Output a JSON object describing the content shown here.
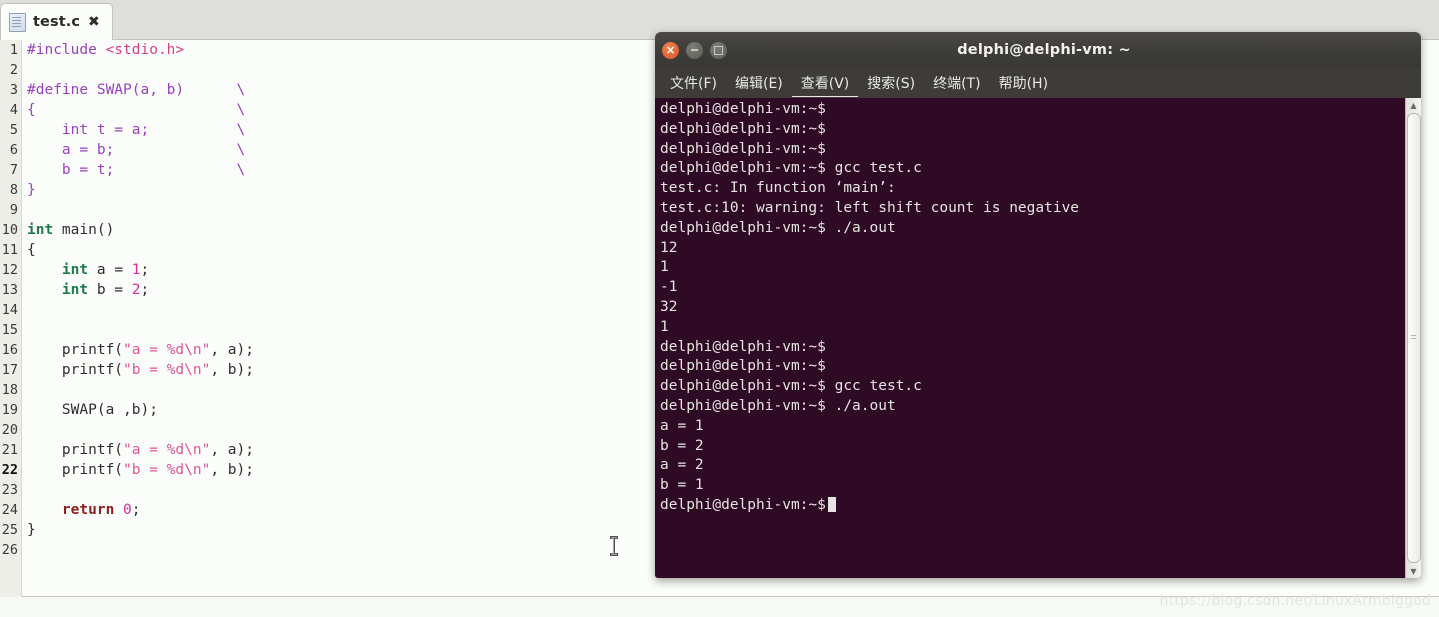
{
  "editor": {
    "tab": {
      "label": "test.c",
      "close_glyph": "✖",
      "icon": "document-icon"
    },
    "gutter_bg": "#edeee8",
    "background": "#fbfdfa",
    "current_line": 22,
    "lines": [
      {
        "n": 1,
        "tokens": [
          {
            "t": "#include ",
            "c": "pre"
          },
          {
            "t": "<stdio.h>",
            "c": "inc"
          }
        ]
      },
      {
        "n": 2,
        "tokens": []
      },
      {
        "n": 3,
        "tokens": [
          {
            "t": "#define SWAP(a, b)      \\",
            "c": "pre"
          }
        ]
      },
      {
        "n": 4,
        "tokens": [
          {
            "t": "{                       \\",
            "c": "pre"
          }
        ]
      },
      {
        "n": 5,
        "tokens": [
          {
            "t": "    int t = a;          \\",
            "c": "pre"
          }
        ]
      },
      {
        "n": 6,
        "tokens": [
          {
            "t": "    a = b;              \\",
            "c": "pre"
          }
        ]
      },
      {
        "n": 7,
        "tokens": [
          {
            "t": "    b = t;              \\",
            "c": "pre"
          }
        ]
      },
      {
        "n": 8,
        "tokens": [
          {
            "t": "}",
            "c": "pre"
          }
        ]
      },
      {
        "n": 9,
        "tokens": []
      },
      {
        "n": 10,
        "tokens": [
          {
            "t": "int",
            "c": "kw"
          },
          {
            "t": " main()",
            "c": "plain"
          }
        ]
      },
      {
        "n": 11,
        "tokens": [
          {
            "t": "{",
            "c": "plain"
          }
        ]
      },
      {
        "n": 12,
        "tokens": [
          {
            "t": "    ",
            "c": "plain"
          },
          {
            "t": "int",
            "c": "kw"
          },
          {
            "t": " a = ",
            "c": "plain"
          },
          {
            "t": "1",
            "c": "num"
          },
          {
            "t": ";",
            "c": "plain"
          }
        ]
      },
      {
        "n": 13,
        "tokens": [
          {
            "t": "    ",
            "c": "plain"
          },
          {
            "t": "int",
            "c": "kw"
          },
          {
            "t": " b = ",
            "c": "plain"
          },
          {
            "t": "2",
            "c": "num"
          },
          {
            "t": ";",
            "c": "plain"
          }
        ]
      },
      {
        "n": 14,
        "tokens": []
      },
      {
        "n": 15,
        "tokens": []
      },
      {
        "n": 16,
        "tokens": [
          {
            "t": "    printf(",
            "c": "plain"
          },
          {
            "t": "\"a = %d\\n\"",
            "c": "str"
          },
          {
            "t": ", a);",
            "c": "plain"
          }
        ]
      },
      {
        "n": 17,
        "tokens": [
          {
            "t": "    printf(",
            "c": "plain"
          },
          {
            "t": "\"b = %d\\n\"",
            "c": "str"
          },
          {
            "t": ", b);",
            "c": "plain"
          }
        ]
      },
      {
        "n": 18,
        "tokens": []
      },
      {
        "n": 19,
        "tokens": [
          {
            "t": "    SWAP(a ,b);",
            "c": "plain"
          }
        ]
      },
      {
        "n": 20,
        "tokens": []
      },
      {
        "n": 21,
        "tokens": [
          {
            "t": "    printf(",
            "c": "plain"
          },
          {
            "t": "\"a = %d\\n\"",
            "c": "str"
          },
          {
            "t": ", a);",
            "c": "plain"
          }
        ]
      },
      {
        "n": 22,
        "tokens": [
          {
            "t": "    printf(",
            "c": "plain"
          },
          {
            "t": "\"b = %d\\n\"",
            "c": "str"
          },
          {
            "t": ", b);",
            "c": "plain"
          }
        ]
      },
      {
        "n": 23,
        "tokens": []
      },
      {
        "n": 24,
        "tokens": [
          {
            "t": "    ",
            "c": "plain"
          },
          {
            "t": "return",
            "c": "ret"
          },
          {
            "t": " ",
            "c": "plain"
          },
          {
            "t": "0",
            "c": "num"
          },
          {
            "t": ";",
            "c": "plain"
          }
        ]
      },
      {
        "n": 25,
        "tokens": [
          {
            "t": "}",
            "c": "plain"
          }
        ]
      },
      {
        "n": 26,
        "tokens": []
      }
    ]
  },
  "terminal": {
    "title": "delphi@delphi-vm: ~",
    "window_buttons": [
      {
        "name": "close",
        "label": "×"
      },
      {
        "name": "minimize",
        "label": "–"
      },
      {
        "name": "maximize",
        "label": "□"
      }
    ],
    "menu": [
      {
        "label": "文件(F)",
        "name": "file"
      },
      {
        "label": "编辑(E)",
        "name": "edit"
      },
      {
        "label": "查看(V)",
        "name": "view"
      },
      {
        "label": "搜索(S)",
        "name": "search"
      },
      {
        "label": "终端(T)",
        "name": "terminal"
      },
      {
        "label": "帮助(H)",
        "name": "help"
      }
    ],
    "background": "#2f0a24",
    "foreground": "#e6e4e1",
    "prompt": "delphi@delphi-vm:~$",
    "lines": [
      "delphi@delphi-vm:~$",
      "delphi@delphi-vm:~$",
      "delphi@delphi-vm:~$",
      "delphi@delphi-vm:~$ gcc test.c",
      "test.c: In function ‘main’:",
      "test.c:10: warning: left shift count is negative",
      "delphi@delphi-vm:~$ ./a.out",
      "12",
      "1",
      "-1",
      "32",
      "1",
      "delphi@delphi-vm:~$",
      "delphi@delphi-vm:~$",
      "delphi@delphi-vm:~$ gcc test.c",
      "delphi@delphi-vm:~$ ./a.out",
      "a = 1",
      "b = 2",
      "a = 2",
      "b = 1"
    ],
    "last_line": "delphi@delphi-vm:~$",
    "scrollbar": {
      "up_glyph": "▲",
      "down_glyph": "▼"
    }
  },
  "watermark": "https://blog.csdn.net/LinuxArmbiggod"
}
